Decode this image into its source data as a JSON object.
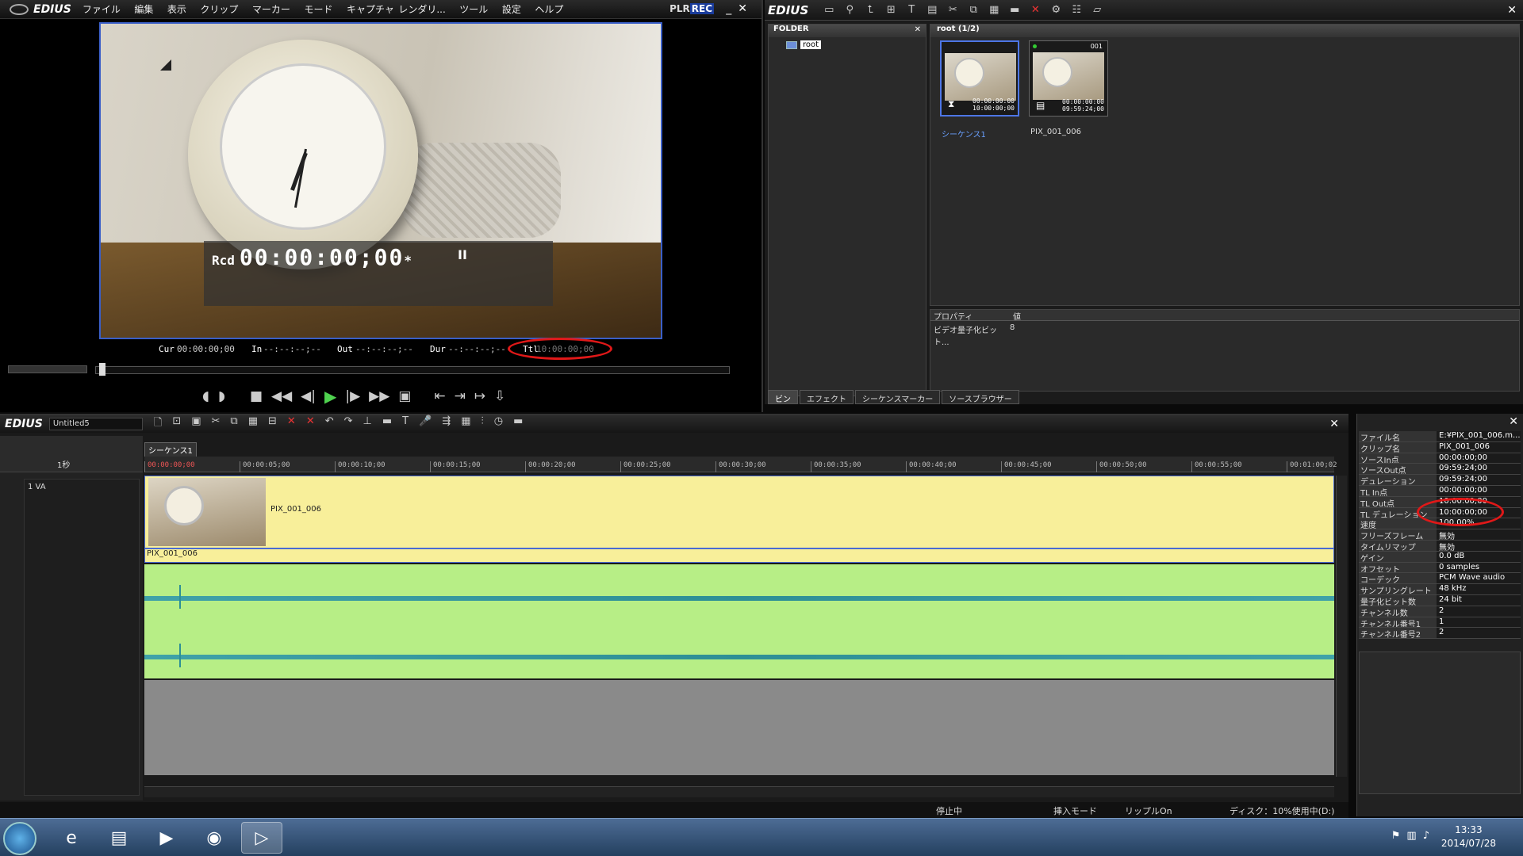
{
  "player": {
    "logo": "EDIUS",
    "menu": [
      "ファイル",
      "編集",
      "表示",
      "クリップ",
      "マーカー",
      "モード",
      "キャプチャ",
      "レンダリ...",
      "ツール",
      "設定",
      "ヘルプ"
    ],
    "plr": "PLR",
    "rec": "REC",
    "osd_rcd": "Rcd",
    "osd_timecode": "00:00:00;00",
    "osd_star": "*",
    "osd_pause": "II",
    "cur_label": "Cur",
    "cur_value": "00:00:00;00",
    "in_label": "In",
    "in_value": "--:--:--;--",
    "out_label": "Out",
    "out_value": "--:--:--;--",
    "dur_label": "Dur",
    "dur_value": "--:--:--;--",
    "ttl_label": "Ttl",
    "ttl_value": "10:00:00;00"
  },
  "bin": {
    "logo": "EDIUS",
    "folder_header": "FOLDER",
    "folder_root": "root",
    "clips_header": "root (1/2)",
    "clips": [
      {
        "name": "シーケンス1",
        "tc1": "00:00:00:00",
        "tc2": "10:00:00;00",
        "num": ""
      },
      {
        "name": "PIX_001_006",
        "tc1": "00:00:00:00",
        "tc2": "09:59:24;00",
        "num": "001"
      }
    ],
    "prop_col1": "プロパティ",
    "prop_col2": "値",
    "prop_key": "ビデオ量子化ビット...",
    "prop_val": "8",
    "tabs": [
      "ビン",
      "エフェクト",
      "シーケンスマーカー",
      "ソースブラウザー"
    ]
  },
  "timeline": {
    "logo": "EDIUS",
    "project": "Untitled5",
    "sequence_tab": "シーケンス1",
    "zoom": "1秒",
    "track_name": "1 VA",
    "ruler": [
      "00:00:00;00",
      "00:00:05;00",
      "00:00:10;00",
      "00:00:15;00",
      "00:00:20;00",
      "00:00:25;00",
      "00:00:30;00",
      "00:00:35;00",
      "00:00:40;00",
      "00:00:45;00",
      "00:00:50;00",
      "00:00:55;00",
      "00:01:00;02"
    ],
    "video_clip": "PIX_001_006",
    "audio_clip": "PIX_001_006",
    "status": [
      "停止中",
      "挿入モード",
      "リップルOn",
      "ディスク：10%使用中(D:)"
    ]
  },
  "info": {
    "rows": [
      {
        "k": "ファイル名",
        "v": "E:¥PIX_001_006.m..."
      },
      {
        "k": "クリップ名",
        "v": "PIX_001_006"
      },
      {
        "k": "ソースIn点",
        "v": "00:00:00;00"
      },
      {
        "k": "ソースOut点",
        "v": "09:59:24;00"
      },
      {
        "k": "デュレーション",
        "v": "09:59:24;00"
      },
      {
        "k": "TL In点",
        "v": "00:00:00;00"
      },
      {
        "k": "TL Out点",
        "v": "10:00:00;00"
      },
      {
        "k": "TL デュレーション",
        "v": "10:00:00;00"
      },
      {
        "k": "速度",
        "v": "100.00%"
      },
      {
        "k": "フリーズフレーム",
        "v": "無効"
      },
      {
        "k": "タイムリマップ",
        "v": "無効"
      },
      {
        "k": "ゲイン",
        "v": "0.0 dB"
      },
      {
        "k": "オフセット",
        "v": "0 samples"
      },
      {
        "k": "コーデック",
        "v": "PCM Wave audio"
      },
      {
        "k": "サンプリングレート",
        "v": "48 kHz"
      },
      {
        "k": "量子化ビット数",
        "v": "24 bit"
      },
      {
        "k": "チャンネル数",
        "v": "2"
      },
      {
        "k": "チャンネル番号1",
        "v": "1"
      },
      {
        "k": "チャンネル番号2",
        "v": "2"
      }
    ]
  },
  "taskbar": {
    "time": "13:33",
    "date": "2014/07/28"
  }
}
